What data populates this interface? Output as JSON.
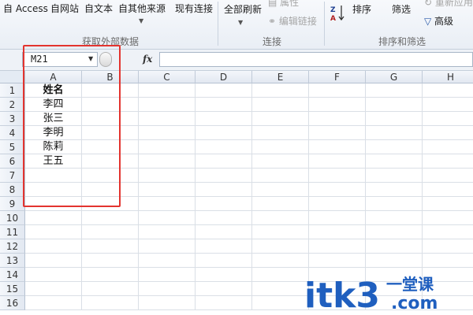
{
  "ribbon": {
    "from_access": "自 Access",
    "from_web": "自网站",
    "from_text": "自文本",
    "from_other": "自其他来源",
    "existing_conn": "现有连接",
    "refresh_all": "全部刷新",
    "properties": "属性",
    "edit_links": "编辑链接",
    "sort": "排序",
    "filter": "筛选",
    "reapply": "重新应用",
    "advanced": "高级",
    "group_get_external": "获取外部数据",
    "group_connections": "连接",
    "group_sort_filter": "排序和筛选"
  },
  "formula_bar": {
    "name_box": "M21",
    "fx_label": "fx",
    "formula": ""
  },
  "sheet": {
    "columns": [
      "A",
      "B",
      "C",
      "D",
      "E",
      "F",
      "G",
      "H"
    ],
    "rows": [
      "1",
      "2",
      "3",
      "4",
      "5",
      "6",
      "7",
      "8",
      "9",
      "10",
      "11",
      "12",
      "13",
      "14",
      "15",
      "16"
    ],
    "col_a": [
      "姓名",
      "李四",
      "张三",
      "李明",
      "陈莉",
      "王五"
    ]
  },
  "watermark": {
    "text": "itk3",
    "dot_com": ".com",
    "cn": "一堂课"
  },
  "colors": {
    "highlight_box": "#e3342f",
    "watermark_blue": "#1f5fbf"
  }
}
